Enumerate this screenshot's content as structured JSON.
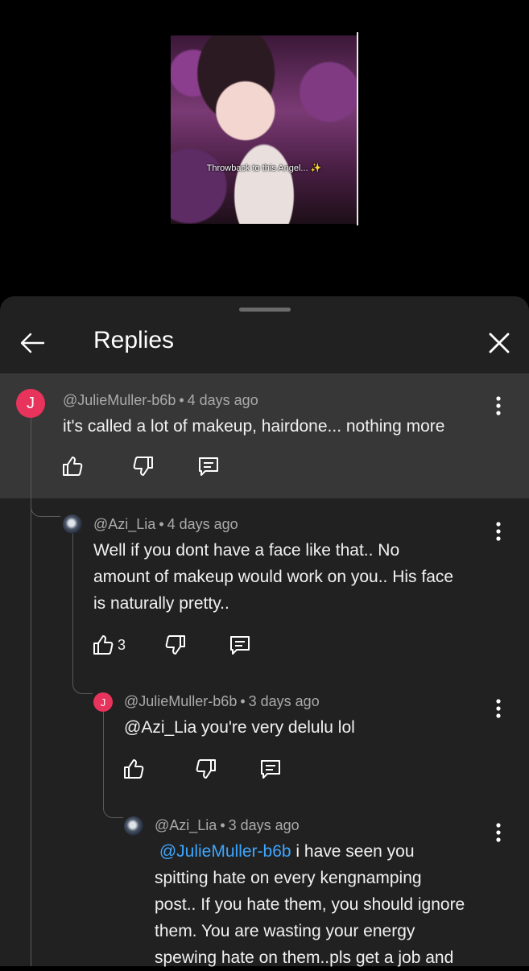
{
  "video": {
    "caption": "Throwback to this Angel... ✨"
  },
  "header": {
    "title": "Replies"
  },
  "comments": [
    {
      "author": "@JulieMuller-b6b",
      "time": "4 days ago",
      "avatar_letter": "J",
      "text": "it's called a lot of makeup, hairdone... nothing more",
      "likes": ""
    },
    {
      "author": "@Azi_Lia",
      "time": "4 days ago",
      "text_lines": [
        "Well if you dont have a face like that.. No",
        "amount of makeup would work on you.. His face",
        "is naturally pretty.."
      ],
      "likes": "3"
    },
    {
      "author": "@JulieMuller-b6b",
      "time": "3 days ago",
      "avatar_letter": "J",
      "text": "@Azi_Lia you're very delulu lol",
      "likes": ""
    },
    {
      "author": "@Azi_Lia",
      "time": "3 days ago",
      "mention": "@JulieMuller-b6b",
      "text_first": " i have seen you",
      "text_lines": [
        "spitting hate on every kengnamping",
        "post.. If you hate them, you should ignore",
        "them. You are wasting your energy",
        "spewing hate on them..pls get a job and"
      ]
    }
  ],
  "separator": "•",
  "colors": {
    "sheet": "#212121",
    "highlight": "#373737",
    "avatar_j": "#e8345c",
    "mention": "#3ea6ff"
  },
  "icons": [
    "back-arrow-icon",
    "close-icon",
    "like-icon",
    "dislike-icon",
    "reply-icon",
    "more-vert-icon"
  ]
}
